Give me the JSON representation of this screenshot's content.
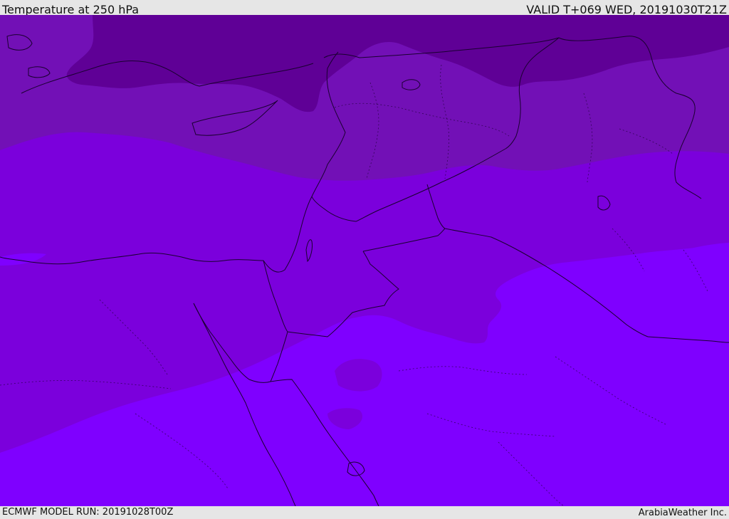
{
  "header": {
    "title": "Temperature at 250 hPa",
    "valid": "VALID T+069 WED, 20191030T21Z"
  },
  "footer": {
    "model_run": "ECMWF MODEL RUN: 20191028T00Z",
    "credit": "ArabiaWeather Inc."
  },
  "colors": {
    "band_darkest": "#5f0096",
    "band_dark": "#7210b6",
    "band_mid": "#7b00dc",
    "band_bright": "#7f00ff",
    "border_line": "#1a0030",
    "frame": "#e6e6e6"
  }
}
